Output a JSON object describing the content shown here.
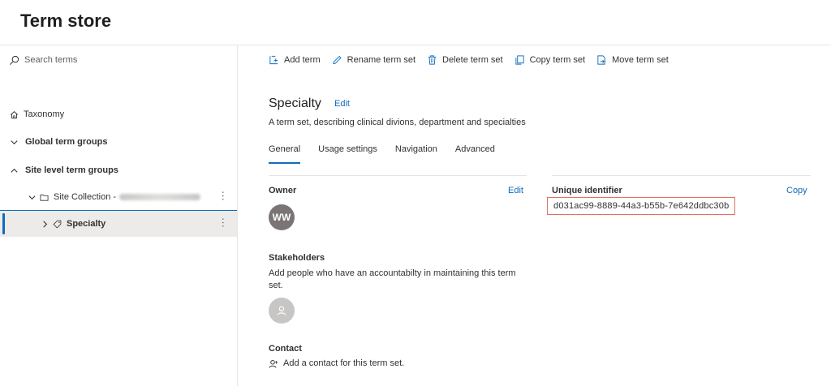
{
  "header": {
    "title": "Term store"
  },
  "sidebar": {
    "search_placeholder": "Search terms",
    "tree": {
      "taxonomy": "Taxonomy",
      "global_groups": "Global term groups",
      "site_groups": "Site level term groups",
      "site_collection": "Site Collection -",
      "selected_set": "Specialty"
    }
  },
  "commands": {
    "add_term": "Add term",
    "rename_term_set": "Rename term set",
    "delete_term_set": "Delete term set",
    "copy_term_set": "Copy term set",
    "move_term_set": "Move term set"
  },
  "term_set": {
    "name": "Specialty",
    "edit_label": "Edit",
    "description": "A term set, describing clinical divions, department and specialties"
  },
  "tabs": [
    "General",
    "Usage settings",
    "Navigation",
    "Advanced"
  ],
  "general": {
    "owner_label": "Owner",
    "owner_edit": "Edit",
    "owner_initials": "WW",
    "stakeholders_label": "Stakeholders",
    "stakeholders_text": "Add people who have an accountabilty in maintaining this term set.",
    "contact_label": "Contact",
    "contact_text": "Add a contact for this term set.",
    "uid_label": "Unique identifier",
    "uid_copy": "Copy",
    "uid_value": "d031ac99-8889-44a3-b55b-7e642ddbc30b"
  },
  "colors": {
    "accent": "#0f6cbd",
    "highlight_box": "#e07060"
  }
}
